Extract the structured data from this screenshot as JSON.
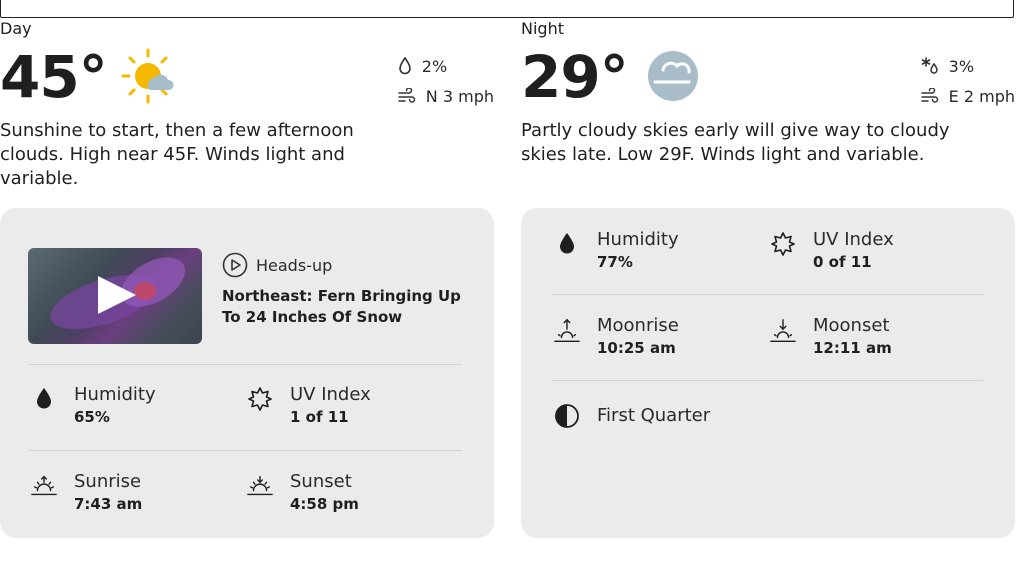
{
  "day": {
    "period": "Day",
    "temp": "45°",
    "icon": "partly-sunny-icon",
    "precip": "2%",
    "wind": "N 3 mph",
    "description": "Sunshine to start, then a few afternoon clouds. High near 45F. Winds light and variable.",
    "video": {
      "tag": "Heads-up",
      "headline": "Northeast: Fern Bringing Up To 24 Inches Of Snow"
    },
    "humidity": {
      "label": "Humidity",
      "value": "65%"
    },
    "uv": {
      "label": "UV Index",
      "value": "1 of 11"
    },
    "sunrise": {
      "label": "Sunrise",
      "value": "7:43 am"
    },
    "sunset": {
      "label": "Sunset",
      "value": "4:58 pm"
    }
  },
  "night": {
    "period": "Night",
    "temp": "29°",
    "icon": "cloudy-night-icon",
    "precip": "3%",
    "wind": "E 2 mph",
    "description": "Partly cloudy skies early will give way to cloudy skies late. Low 29F. Winds light and variable.",
    "humidity": {
      "label": "Humidity",
      "value": "77%"
    },
    "uv": {
      "label": "UV Index",
      "value": "0 of 11"
    },
    "moonrise": {
      "label": "Moonrise",
      "value": "10:25 am"
    },
    "moonset": {
      "label": "Moonset",
      "value": "12:11 am"
    },
    "moon_phase": "First Quarter"
  },
  "colors": {
    "sun": "#f5b800",
    "cloud": "#a9bdc8",
    "card": "#ebebeb"
  }
}
